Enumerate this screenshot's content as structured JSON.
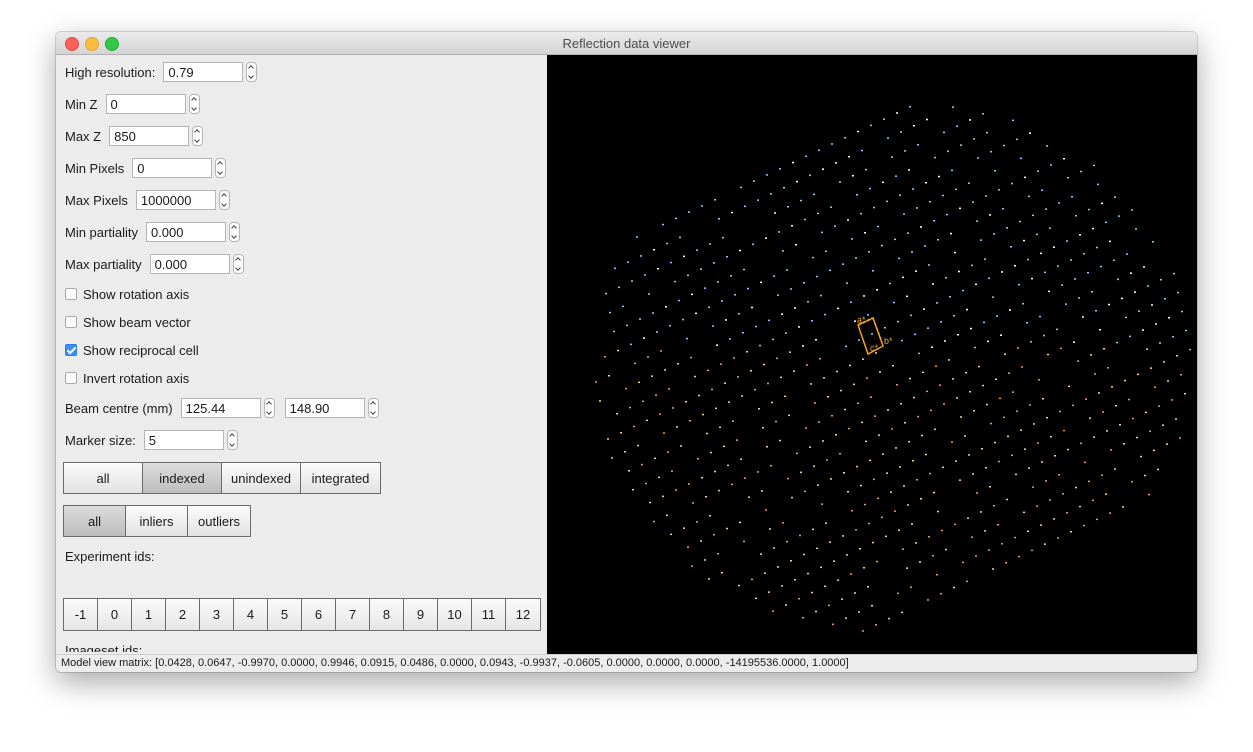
{
  "window": {
    "title": "Reflection data viewer"
  },
  "controls": {
    "high_resolution": {
      "label": "High resolution:",
      "value": "0.79"
    },
    "min_z": {
      "label": "Min Z",
      "value": "0"
    },
    "max_z": {
      "label": "Max Z",
      "value": "850"
    },
    "min_pixels": {
      "label": "Min Pixels",
      "value": "0"
    },
    "max_pixels": {
      "label": "Max Pixels",
      "value": "1000000"
    },
    "min_partiality": {
      "label": "Min partiality",
      "value": "0.000"
    },
    "max_partiality": {
      "label": "Max partiality",
      "value": "0.000"
    },
    "show_rotation_axis": {
      "label": "Show rotation axis",
      "checked": false
    },
    "show_beam_vector": {
      "label": "Show beam vector",
      "checked": false
    },
    "show_reciprocal_cell": {
      "label": "Show reciprocal cell",
      "checked": true
    },
    "invert_rotation_axis": {
      "label": "Invert rotation axis",
      "checked": false
    },
    "beam_centre": {
      "label": "Beam centre (mm)",
      "x": "125.44",
      "y": "148.90"
    },
    "marker_size": {
      "label": "Marker size:",
      "value": "5"
    }
  },
  "filter_group_1": {
    "options": [
      "all",
      "indexed",
      "unindexed",
      "integrated"
    ],
    "selected": "indexed"
  },
  "filter_group_2": {
    "options": [
      "all",
      "inliers",
      "outliers"
    ],
    "selected": "all"
  },
  "experiment_ids": {
    "label": "Experiment ids:",
    "ids": [
      "-1",
      "0",
      "1",
      "2",
      "3",
      "4",
      "5",
      "6",
      "7",
      "8",
      "9",
      "10",
      "11",
      "12"
    ]
  },
  "imageset_ids": {
    "label": "Imageset ids:"
  },
  "viewer": {
    "cell_labels": {
      "a": "a*",
      "b": "b*",
      "c": "c*"
    },
    "colors": {
      "background": "#000000",
      "cell": "#f0a020"
    }
  },
  "status": {
    "text": "Model view matrix: [0.0428, 0.0647, -0.9970, 0.0000, 0.9946, 0.0915, 0.0486, 0.0000, 0.0943, -0.9937, -0.0605, 0.0000, 0.0000, 0.0000, -14195536.0000, 1.0000]"
  }
}
